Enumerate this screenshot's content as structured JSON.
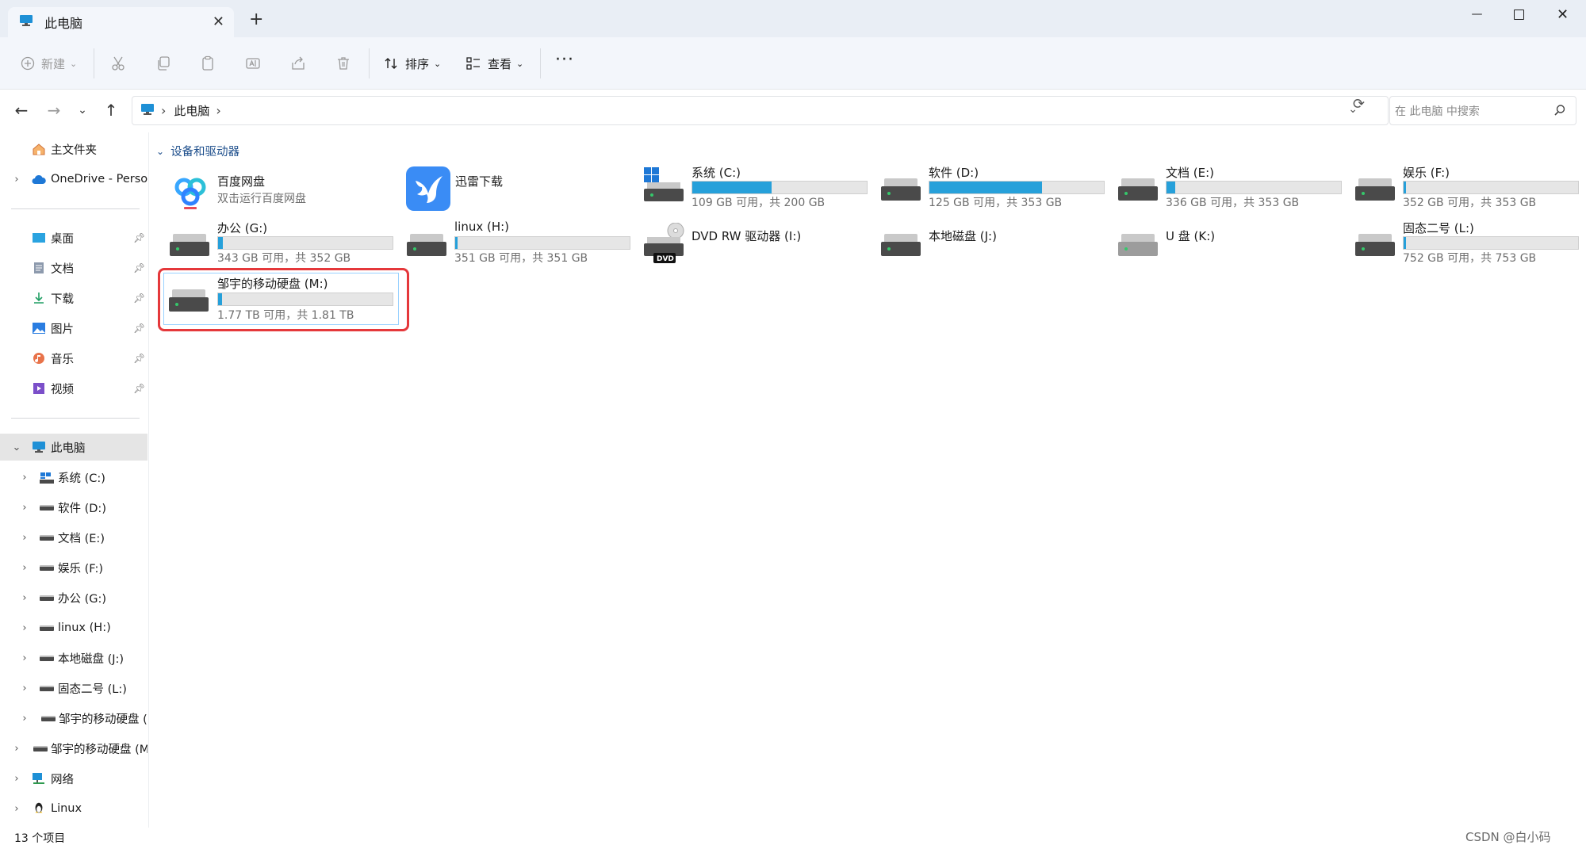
{
  "window": {
    "tab_title": "此电脑",
    "new_tab": "+",
    "close_tab": "✕",
    "minimize": "—",
    "close": "✕"
  },
  "toolbar": {
    "new_label": "新建",
    "sort_label": "排序",
    "view_label": "查看",
    "more_label": "···"
  },
  "nav": {
    "breadcrumb": [
      "此电脑"
    ],
    "search_placeholder": "在 此电脑 中搜索"
  },
  "sidebar": {
    "home": "主文件夹",
    "onedrive": "OneDrive - Personal",
    "quick": [
      {
        "label": "桌面"
      },
      {
        "label": "文档"
      },
      {
        "label": "下载"
      },
      {
        "label": "图片"
      },
      {
        "label": "音乐"
      },
      {
        "label": "视频"
      }
    ],
    "this_pc": "此电脑",
    "drives": [
      {
        "label": "系统 (C:)"
      },
      {
        "label": "软件 (D:)"
      },
      {
        "label": "文档 (E:)"
      },
      {
        "label": "娱乐 (F:)"
      },
      {
        "label": "办公 (G:)"
      },
      {
        "label": "linux (H:)"
      },
      {
        "label": "本地磁盘 (J:)"
      },
      {
        "label": "固态二号 (L:)"
      },
      {
        "label": "邹宇的移动硬盘 (M:)"
      }
    ],
    "external": "邹宇的移动硬盘 (M:)",
    "network": "网络",
    "linux": "Linux"
  },
  "main": {
    "group_title": "设备和驱动器",
    "apps": [
      {
        "name": "百度网盘",
        "desc": "双击运行百度网盘"
      },
      {
        "name": "迅雷下载"
      }
    ],
    "drives": [
      {
        "name": "系统 (C:)",
        "info": "109 GB 可用，共 200 GB",
        "used_fraction": 0.455
      },
      {
        "name": "软件 (D:)",
        "info": "125 GB 可用，共 353 GB",
        "used_fraction": 0.646
      },
      {
        "name": "文档 (E:)",
        "info": "336 GB 可用，共 353 GB",
        "used_fraction": 0.048
      },
      {
        "name": "娱乐 (F:)",
        "info": "352 GB 可用，共 353 GB",
        "used_fraction": 0.003
      },
      {
        "name": "办公 (G:)",
        "info": "343 GB 可用，共 352 GB",
        "used_fraction": 0.026
      },
      {
        "name": "linux (H:)",
        "info": "351 GB 可用，共 351 GB",
        "used_fraction": 0.0
      },
      {
        "name": "DVD RW 驱动器 (I:)"
      },
      {
        "name": "本地磁盘 (J:)"
      },
      {
        "name": "U 盘 (K:)"
      },
      {
        "name": "固态二号 (L:)",
        "info": "752 GB 可用，共 753 GB",
        "used_fraction": 0.001
      },
      {
        "name": "邹宇的移动硬盘 (M:)",
        "info": "1.77 TB 可用，共 1.81 TB",
        "used_fraction": 0.022
      }
    ],
    "dvd_badge": "DVD"
  },
  "status": {
    "count": "13 个项目"
  },
  "watermark": "CSDN @白小码",
  "colors": {
    "accent": "#26a0da",
    "highlight_box": "#e5383b"
  }
}
